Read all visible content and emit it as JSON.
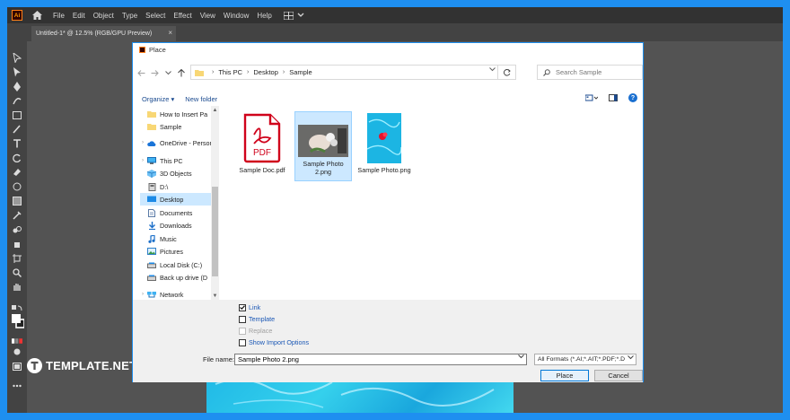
{
  "app": {
    "logo_text": "Ai",
    "menus": [
      "File",
      "Edit",
      "Object",
      "Type",
      "Select",
      "Effect",
      "View",
      "Window",
      "Help"
    ],
    "document_tab": "Untitled-1* @ 12.5% (RGB/GPU Preview)",
    "document_tab_close": "×"
  },
  "dialog": {
    "title": "Place",
    "breadcrumb": [
      "This PC",
      "Desktop",
      "Sample"
    ],
    "search_placeholder": "Search Sample",
    "organize_label": "Organize ▾",
    "new_folder_label": "New folder",
    "help_label": "?",
    "nav_items": [
      {
        "label": "How to Insert Pa",
        "icon": "folder-icon"
      },
      {
        "label": "Sample",
        "icon": "folder-icon"
      },
      {
        "label": "OneDrive - Person",
        "icon": "cloud-icon"
      },
      {
        "label": "This PC",
        "icon": "computer-icon"
      },
      {
        "label": "3D Objects",
        "icon": "cube-icon"
      },
      {
        "label": "D:\\",
        "icon": "drive-icon"
      },
      {
        "label": "Desktop",
        "icon": "desktop-icon"
      },
      {
        "label": "Documents",
        "icon": "document-icon"
      },
      {
        "label": "Downloads",
        "icon": "download-icon"
      },
      {
        "label": "Music",
        "icon": "music-icon"
      },
      {
        "label": "Pictures",
        "icon": "pictures-icon"
      },
      {
        "label": "Local Disk (C:)",
        "icon": "disk-icon"
      },
      {
        "label": "Back up drive (D",
        "icon": "disk-icon"
      },
      {
        "label": "Network",
        "icon": "network-icon"
      }
    ],
    "files": [
      {
        "name": "Sample Doc.pdf",
        "thumb_text": "PDF"
      },
      {
        "name": "Sample Photo 2.png"
      },
      {
        "name": "Sample Photo.png"
      }
    ],
    "options": {
      "link": "Link",
      "template": "Template",
      "replace": "Replace",
      "show_import": "Show Import Options"
    },
    "file_name_label": "File name:",
    "file_name_value": "Sample Photo 2.png",
    "filter_value": "All Formats (*.AI;*.AIT;*.PDF;*.D",
    "place_label": "Place",
    "cancel_label": "Cancel"
  },
  "watermark": {
    "text": "TEMPLATE.NET"
  },
  "colors": {
    "accent": "#1e8ff0",
    "selection": "#cce8ff",
    "ai_orange": "#ff9a00",
    "pdf_red": "#d0021b"
  }
}
